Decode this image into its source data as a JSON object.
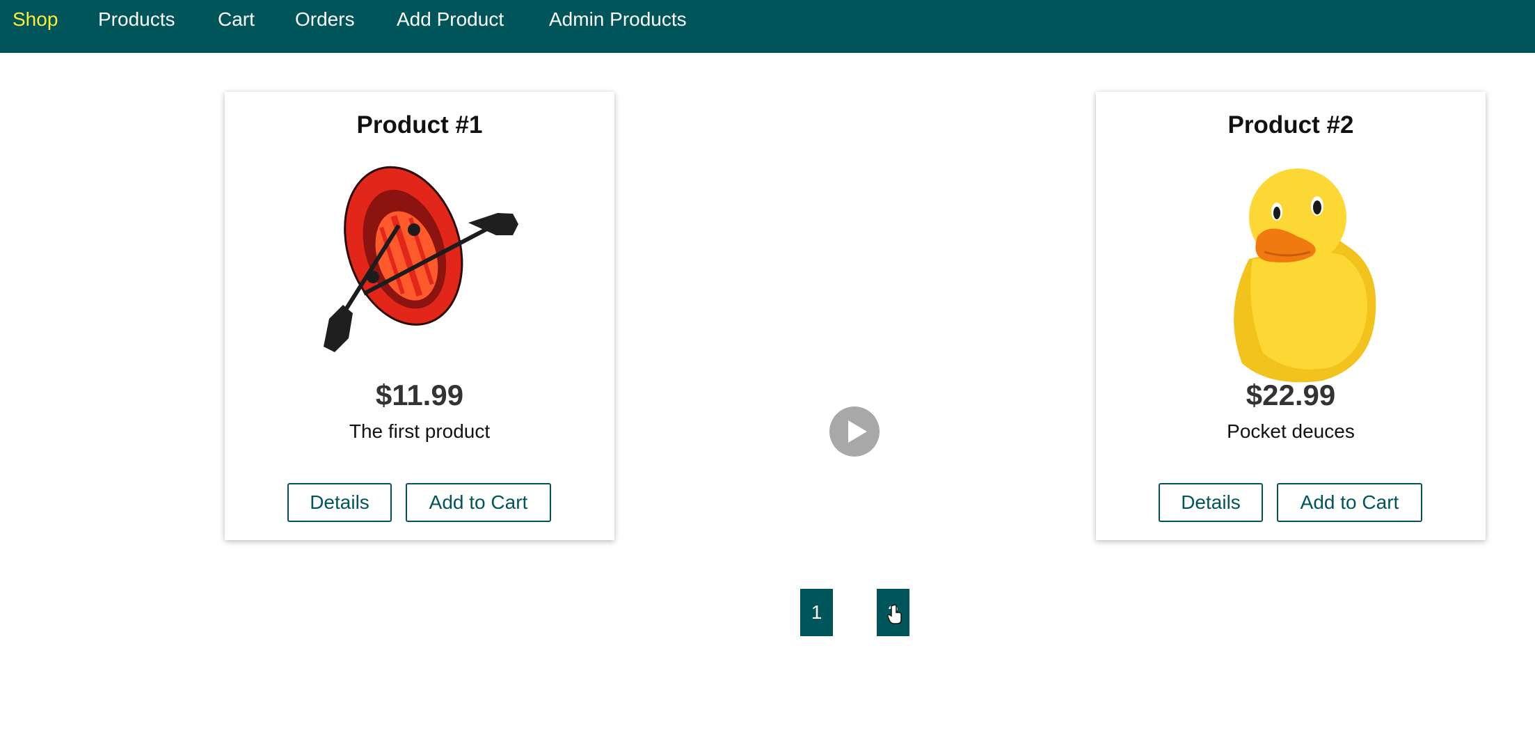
{
  "nav": {
    "items": [
      {
        "label": "Shop",
        "active": true
      },
      {
        "label": "Products",
        "active": false
      },
      {
        "label": "Cart",
        "active": false
      },
      {
        "label": "Orders",
        "active": false
      },
      {
        "label": "Add Product",
        "active": false
      },
      {
        "label": "Admin Products",
        "active": false
      }
    ]
  },
  "products": [
    {
      "title": "Product #1",
      "image_icon": "inflatable-boat-icon",
      "price": "$11.99",
      "description": "The first product",
      "details_label": "Details",
      "add_to_cart_label": "Add to Cart"
    },
    {
      "title": "Product #2",
      "image_icon": "rubber-duck-icon",
      "price": "$22.99",
      "description": "Pocket deuces",
      "details_label": "Details",
      "add_to_cart_label": "Add to Cart"
    }
  ],
  "media": {
    "icon": "play-icon"
  },
  "pagination": {
    "pages": [
      "1",
      "2"
    ]
  },
  "colors": {
    "nav_bg": "#00555a",
    "accent": "#00555a",
    "active_nav": "#ffeb3b"
  }
}
